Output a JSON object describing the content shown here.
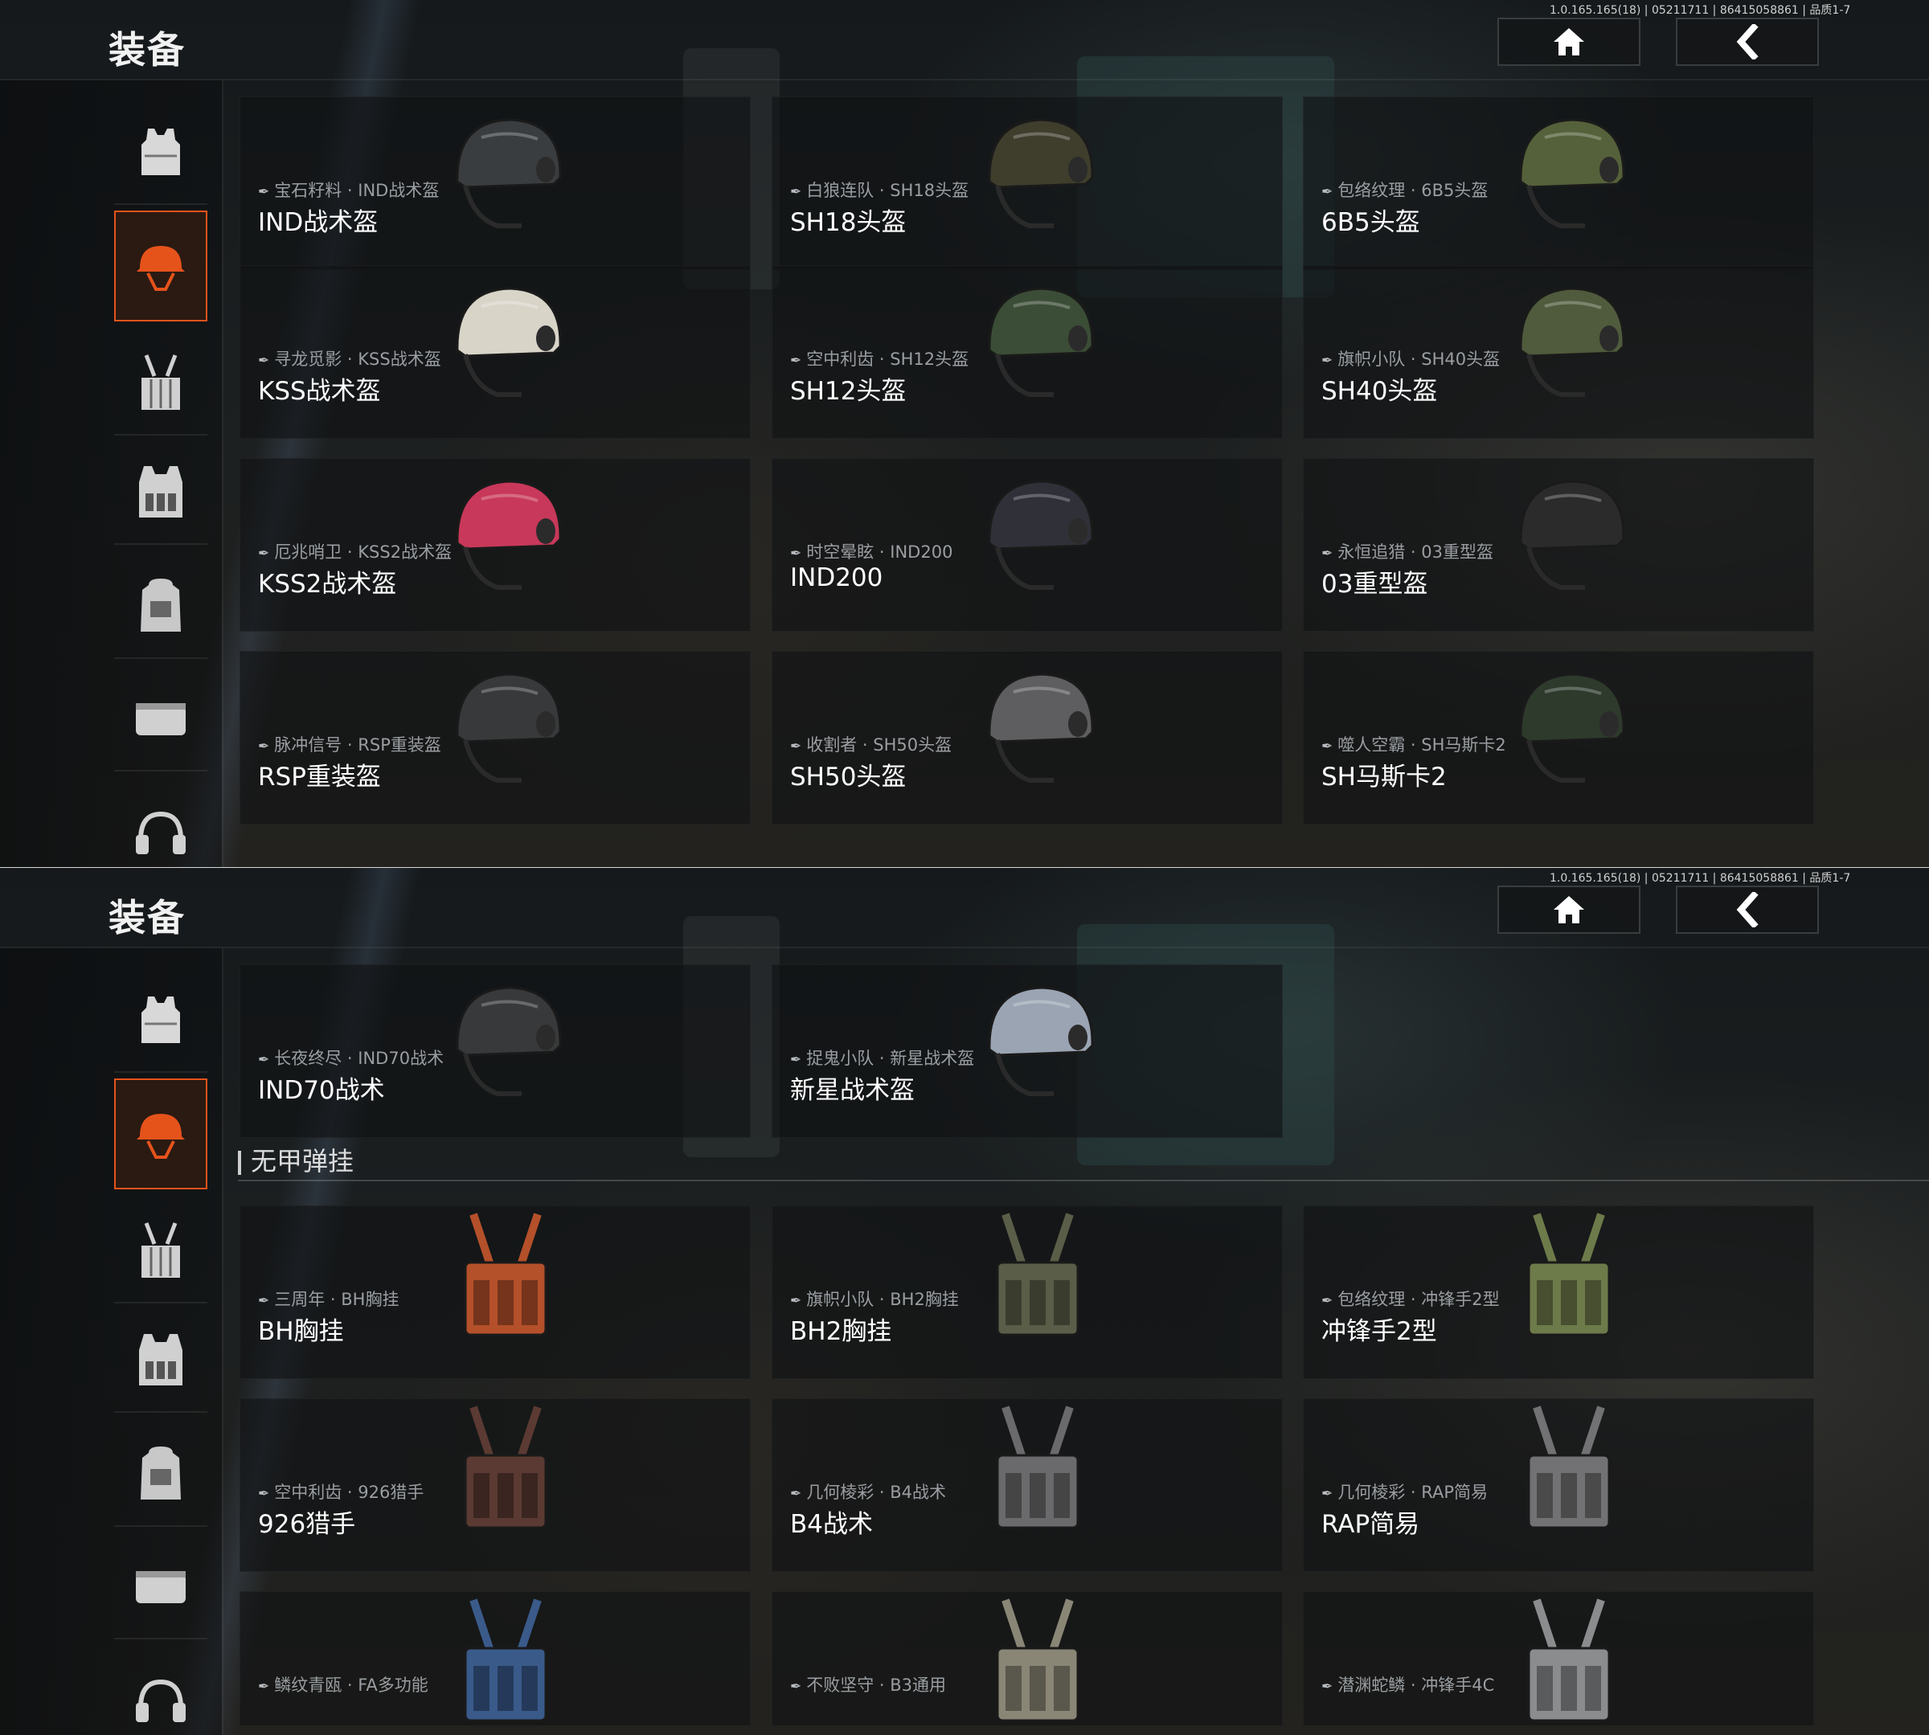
{
  "screen": {
    "title": "装备",
    "version": "1.0.165.165(18) | 05211711 | 86415058861 | 品质1-7",
    "home_icon": "home-icon",
    "back_icon": "chevron-left-icon"
  },
  "sidebar": {
    "items": [
      {
        "icon": "body-armor-icon",
        "active": false
      },
      {
        "icon": "helmet-icon",
        "active": true
      },
      {
        "icon": "chest-rig-icon",
        "active": false
      },
      {
        "icon": "tactical-vest-icon",
        "active": false
      },
      {
        "icon": "backpack-icon",
        "active": false
      },
      {
        "icon": "pouch-icon",
        "active": false
      },
      {
        "icon": "headset-icon",
        "active": false
      }
    ],
    "accent": "#e5531b"
  },
  "panel1": {
    "cards": [
      {
        "skin": "宝石籽料 · IND战术盔",
        "name": "IND战术盔",
        "color": "#3a3d3f"
      },
      {
        "skin": "白狼连队 · SH18头盔",
        "name": "SH18头盔",
        "color": "#3f3d2c"
      },
      {
        "skin": "包络纹理 · 6B5头盔",
        "name": "6B5头盔",
        "color": "#55613a"
      },
      {
        "skin": "寻龙觅影 · KSS战术盔",
        "name": "KSS战术盔",
        "color": "#d8d4c8"
      },
      {
        "skin": "空中利齿 · SH12头盔",
        "name": "SH12头盔",
        "color": "#3b4d36"
      },
      {
        "skin": "旗帜小队 · SH40头盔",
        "name": "SH40头盔",
        "color": "#4f5b3c"
      },
      {
        "skin": "厄兆哨卫 · KSS2战术盔",
        "name": "KSS2战术盔",
        "color": "#c8385a"
      },
      {
        "skin": "时空晕眩 · IND200",
        "name": "IND200",
        "color": "#2f3038"
      },
      {
        "skin": "永恒追猎 · 03重型盔",
        "name": "03重型盔",
        "color": "#2b2b2c"
      },
      {
        "skin": "脉冲信号 · RSP重装盔",
        "name": "RSP重装盔",
        "color": "#37393b"
      },
      {
        "skin": "收割者 · SH50头盔",
        "name": "SH50头盔",
        "color": "#5e5e60"
      },
      {
        "skin": "噬人空霸 · SH马斯卡2",
        "name": "SH马斯卡2",
        "color": "#2e3a2c"
      }
    ]
  },
  "panel2": {
    "helmet_cards": [
      {
        "skin": "长夜终尽 · IND70战术",
        "name": "IND70战术",
        "color": "#38393a"
      },
      {
        "skin": "捉鬼小队 · 新星战术盔",
        "name": "新星战术盔",
        "color": "#9aa4b3"
      }
    ],
    "section_title": "无甲弹挂",
    "rig_cards": [
      {
        "skin": "三周年 · BH胸挂",
        "name": "BH胸挂",
        "color": "#b4502a"
      },
      {
        "skin": "旗帜小队 · BH2胸挂",
        "name": "BH2胸挂",
        "color": "#5a5e48"
      },
      {
        "skin": "包络纹理 · 冲锋手2型",
        "name": "冲锋手2型",
        "color": "#6d7a4a"
      },
      {
        "skin": "空中利齿 · 926猎手",
        "name": "926猎手",
        "color": "#5a3a32"
      },
      {
        "skin": "几何棱彩 · B4战术",
        "name": "B4战术",
        "color": "#6a6a6c"
      },
      {
        "skin": "几何棱彩 · RAP简易",
        "name": "RAP简易",
        "color": "#727274"
      },
      {
        "skin": "鳞纹青瓯 · FA多功能",
        "name": "",
        "color": "#3a5a8a"
      },
      {
        "skin": "不败坚守 · B3通用",
        "name": "",
        "color": "#8a8676"
      },
      {
        "skin": "潜渊蛇鳞 · 冲锋手4C",
        "name": "",
        "color": "#8a8c8e"
      }
    ]
  }
}
